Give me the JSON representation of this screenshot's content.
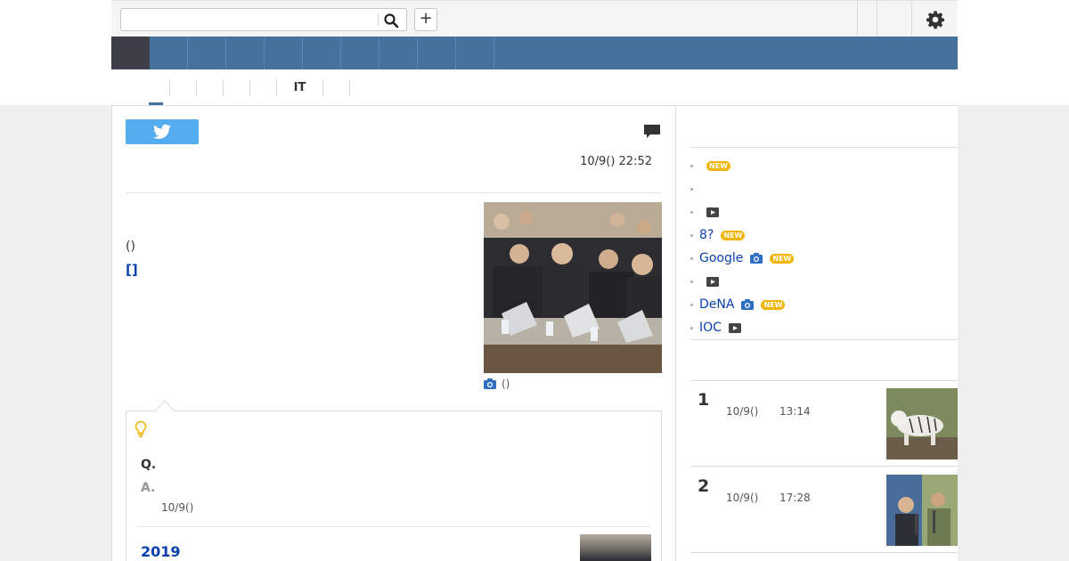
{
  "header": {
    "search": {
      "value": "",
      "placeholder": ""
    },
    "plus_label": "+"
  },
  "nav": {
    "item_count": 9
  },
  "subnav": {
    "items": [
      "",
      "",
      "",
      "",
      "",
      "IT",
      "",
      ""
    ]
  },
  "article": {
    "timestamp": "10/9() 22:52",
    "author": "()",
    "author_link": "[]",
    "photo_caption": "()"
  },
  "qa": {
    "question": "Q.",
    "answer": "A.",
    "date": "10/9()",
    "year_link": "2019"
  },
  "sidebar": {
    "items": [
      {
        "text": "",
        "new": true,
        "camera": false,
        "video": false
      },
      {
        "text": "",
        "new": false,
        "camera": false,
        "video": false
      },
      {
        "text": "",
        "new": false,
        "camera": false,
        "video": true
      },
      {
        "text": "8?",
        "new": true,
        "camera": false,
        "video": false
      },
      {
        "text": "Google",
        "new": true,
        "camera": true,
        "video": false
      },
      {
        "text": "",
        "new": false,
        "camera": false,
        "video": true
      },
      {
        "text": "DeNA",
        "new": true,
        "camera": true,
        "video": false
      },
      {
        "text": "IOC",
        "new": false,
        "camera": false,
        "video": true
      }
    ],
    "new_label": "NEW",
    "ranking": [
      {
        "rank": "1",
        "date": "10/9()",
        "time": "13:14",
        "thumb": "white-tiger-photo"
      },
      {
        "rank": "2",
        "date": "10/9()",
        "time": "17:28",
        "thumb": "people-photo"
      }
    ]
  },
  "colors": {
    "nav_bg": "#46719d",
    "nav_active": "#3c3f47",
    "link": "#0a3fb0",
    "twitter": "#55acee",
    "new_badge": "#f2b400"
  }
}
